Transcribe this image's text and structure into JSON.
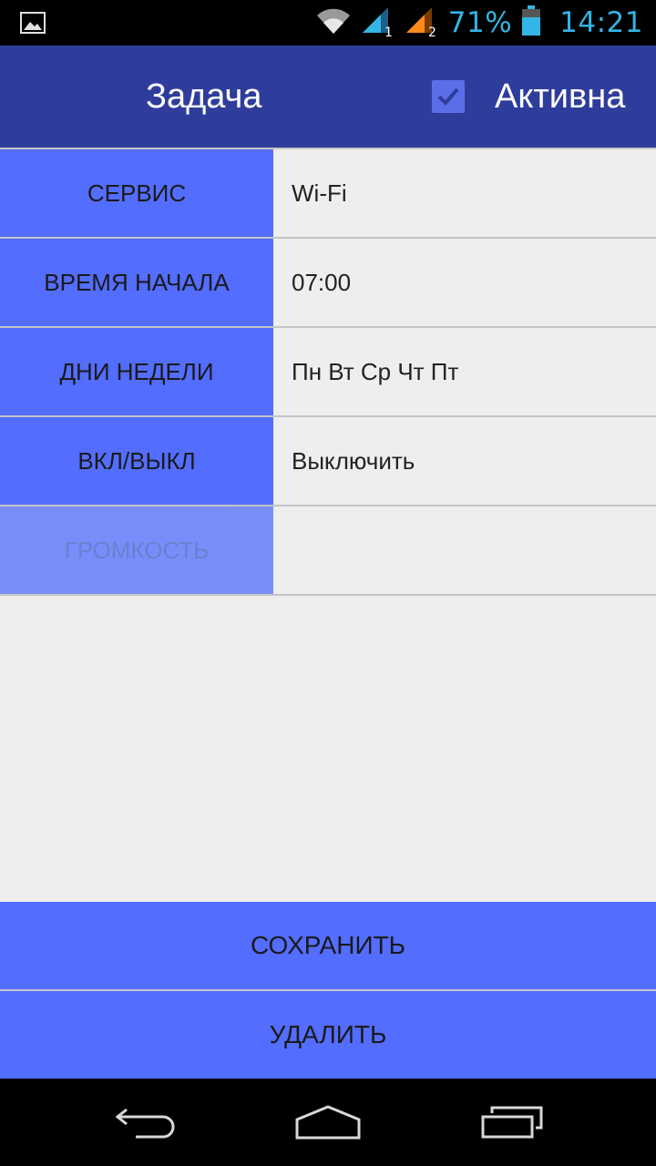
{
  "status_bar": {
    "battery_percent": "71%",
    "time": "14:21",
    "icons": [
      "image-notification-icon",
      "wifi-icon",
      "signal-sim1-icon",
      "signal-sim2-icon",
      "battery-icon"
    ],
    "sim1_label": "1",
    "sim2_label": "2",
    "colors": {
      "primary": "#33b5e5",
      "sim2": "#ff8a1c"
    }
  },
  "action_bar": {
    "title": "Задача",
    "active_checked": true,
    "active_label": "Активна"
  },
  "form": {
    "rows": [
      {
        "label": "СЕРВИС",
        "value": "Wi-Fi",
        "enabled": true
      },
      {
        "label": "ВРЕМЯ НАЧАЛА",
        "value": "07:00",
        "enabled": true
      },
      {
        "label": "ДНИ НЕДЕЛИ",
        "value": "Пн Вт Ср Чт Пт",
        "enabled": true
      },
      {
        "label": "ВКЛ/ВЫКЛ",
        "value": "Выключить",
        "enabled": true
      },
      {
        "label": "ГРОМКОСТЬ",
        "value": "",
        "enabled": false
      }
    ]
  },
  "buttons": {
    "save_label": "СОХРАНИТЬ",
    "delete_label": "УДАЛИТЬ"
  },
  "nav_bar": {
    "icons": [
      "back-icon",
      "home-icon",
      "recent-apps-icon"
    ]
  },
  "colors": {
    "action_bar": "#2e3d9c",
    "accent": "#536dfe",
    "background": "#eeeeee"
  }
}
